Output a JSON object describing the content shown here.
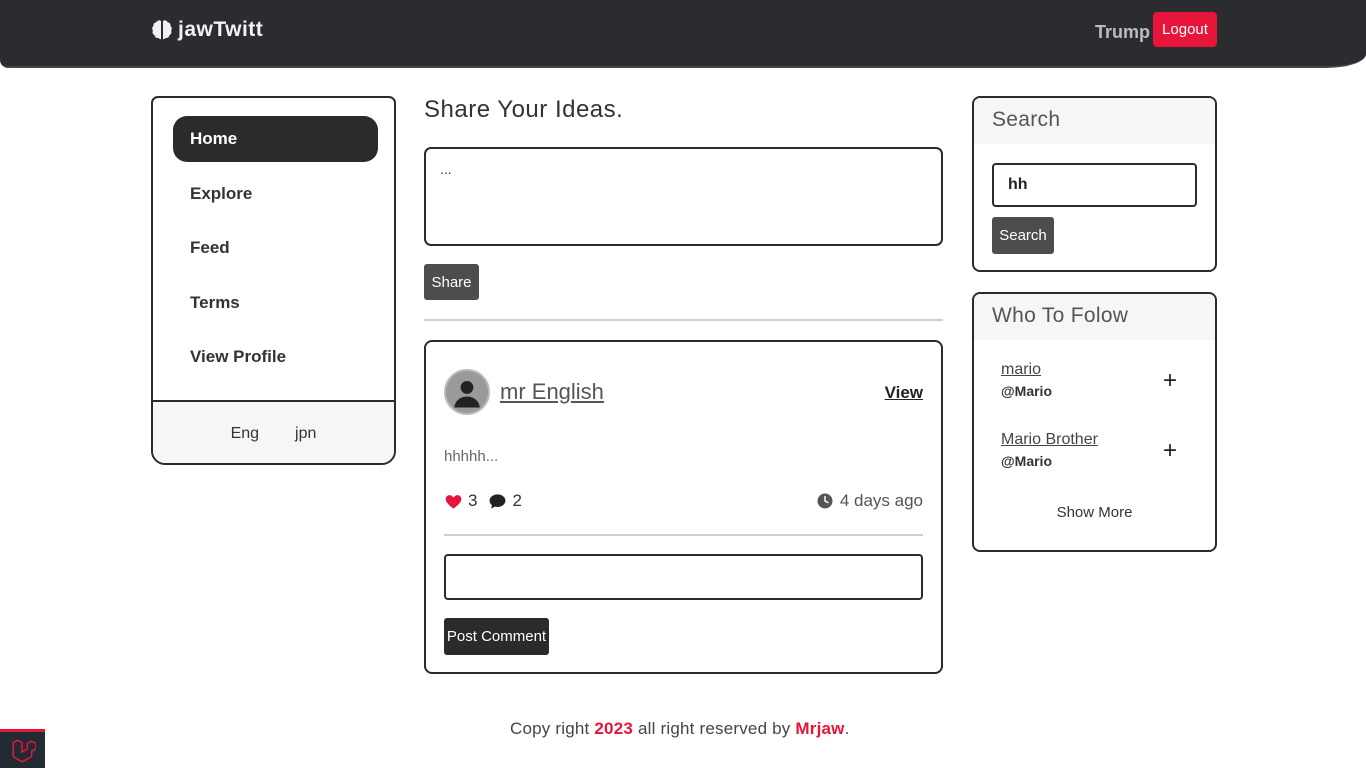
{
  "navbar": {
    "brand": "jawTwitt",
    "user": "Trump",
    "logout_label": "Logout"
  },
  "sidebar": {
    "items": [
      {
        "label": "Home",
        "active": true
      },
      {
        "label": "Explore",
        "active": false
      },
      {
        "label": "Feed",
        "active": false
      },
      {
        "label": "Terms",
        "active": false
      },
      {
        "label": "View Profile",
        "active": false
      }
    ],
    "languages": [
      "Eng",
      "jpn"
    ]
  },
  "share": {
    "title": "Share Your Ideas.",
    "textarea_value": "...",
    "button_label": "Share"
  },
  "post": {
    "author": "mr English",
    "view_label": "View",
    "body": "hhhhh...",
    "likes": "3",
    "comments": "2",
    "time": "4 days ago",
    "comment_value": "",
    "comment_button_label": "Post Comment"
  },
  "search": {
    "title": "Search",
    "input_value": "hh",
    "button_label": "Search"
  },
  "follow": {
    "title": "Who To Folow",
    "items": [
      {
        "name": "mario",
        "handle": "@Mario"
      },
      {
        "name": "Mario Brother",
        "handle": "@Mario"
      }
    ],
    "show_more_label": "Show More"
  },
  "footer": {
    "prefix": "Copy right ",
    "year": "2023",
    "middle": " all right reserved by ",
    "author": "Mrjaw",
    "suffix": "."
  },
  "colors": {
    "accent": "#e8153a",
    "dark": "#2b2b2b",
    "navbar": "#2b2c2f"
  }
}
